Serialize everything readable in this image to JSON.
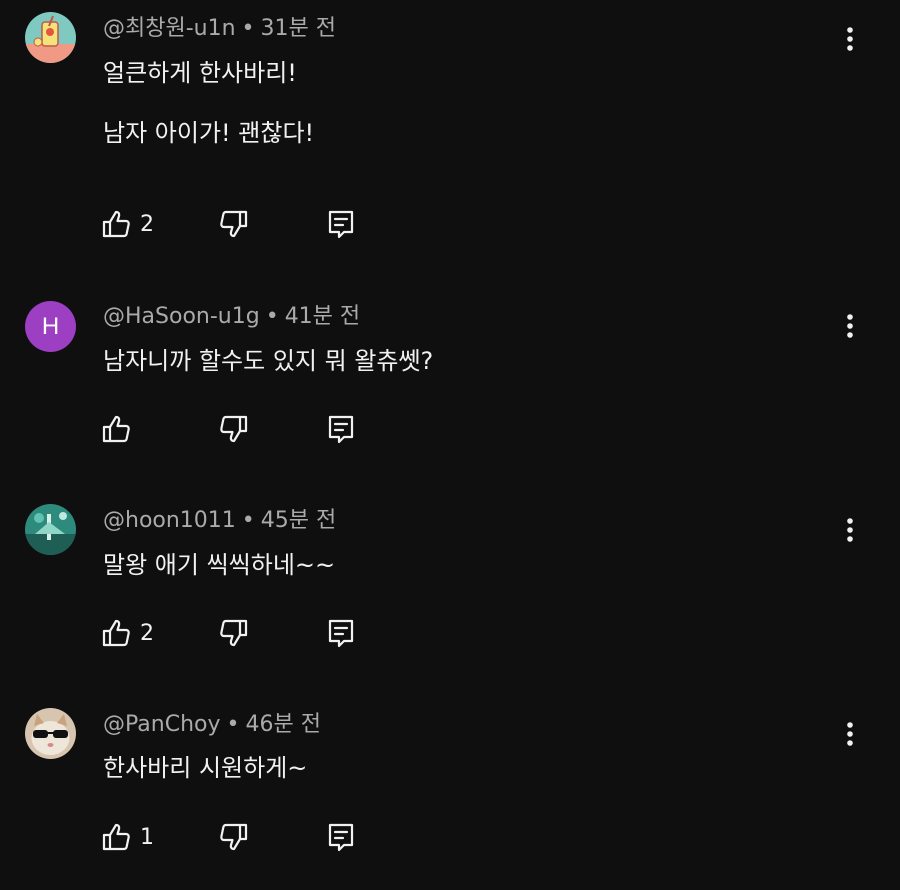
{
  "comments": [
    {
      "author": "@최창원-u1n",
      "time": "31분 전",
      "text": "얼큰하게 한사바리!\n\n남자 아이가! 괜찮다!",
      "likes": "2",
      "avatar": {
        "type": "image",
        "desc": "cartoon drink illustration",
        "bg": "#7fc9c0"
      }
    },
    {
      "author": "@HaSoon-u1g",
      "time": "41분 전",
      "text": "남자니까 할수도 있지 뭐 왈츄쎗?",
      "likes": "",
      "avatar": {
        "type": "letter",
        "letter": "H",
        "bg": "#9c3fc2"
      }
    },
    {
      "author": "@hoon1011",
      "time": "45분 전",
      "text": "말왕 애기 씩씩하네~~",
      "likes": "2",
      "avatar": {
        "type": "image",
        "desc": "teal photo",
        "bg": "#2f8a7e"
      }
    },
    {
      "author": "@PanChoy",
      "time": "46분 전",
      "text": "한사바리 시원하게~",
      "likes": "1",
      "avatar": {
        "type": "image",
        "desc": "cat wearing sunglasses",
        "bg": "#d8c5b0"
      }
    }
  ],
  "colors": {
    "background": "#0f0f0f",
    "primary_text": "#f1f1f1",
    "secondary_text": "#aaaaaa"
  },
  "icons": {
    "like": "thumbs-up-icon",
    "dislike": "thumbs-down-icon",
    "reply": "reply-icon",
    "menu": "more-vertical-icon"
  }
}
